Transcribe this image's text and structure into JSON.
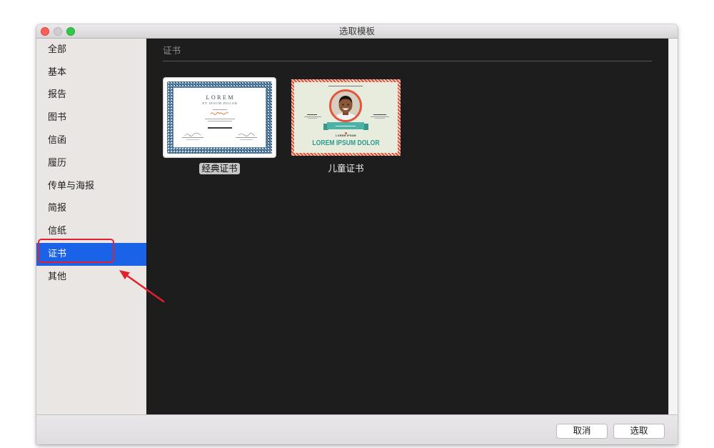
{
  "window": {
    "title": "选取模板",
    "controls": {
      "close": "close-icon",
      "minimize": "minimize-icon",
      "zoom": "zoom-icon"
    }
  },
  "sidebar": {
    "items": [
      {
        "label": "全部"
      },
      {
        "label": "基本"
      },
      {
        "label": "报告"
      },
      {
        "label": "图书"
      },
      {
        "label": "信函"
      },
      {
        "label": "履历"
      },
      {
        "label": "传单与海报"
      },
      {
        "label": "简报"
      },
      {
        "label": "信纸"
      },
      {
        "label": "证书",
        "selected": true
      },
      {
        "label": "其他"
      }
    ]
  },
  "main": {
    "section_title": "证书",
    "templates": [
      {
        "name": "经典证书",
        "selected": true,
        "preview": {
          "title": "LOREM",
          "subtitle": "ET IPSUM DOLOR"
        }
      },
      {
        "name": "儿童证书",
        "selected": false,
        "preview": {
          "caption": "LOREM IPSUM",
          "headline": "LOREM IPSUM DOLOR"
        }
      }
    ]
  },
  "footer": {
    "cancel_label": "取消",
    "choose_label": "选取"
  },
  "colors": {
    "selection_blue": "#1a63e8",
    "annotation_red": "#e5202e",
    "content_background": "#1d1d1d",
    "sidebar_background": "#e9e6e3",
    "headline_teal": "#2c9a90",
    "classic_border_navy": "#2c5678",
    "kids_border_red": "#e14e36"
  }
}
